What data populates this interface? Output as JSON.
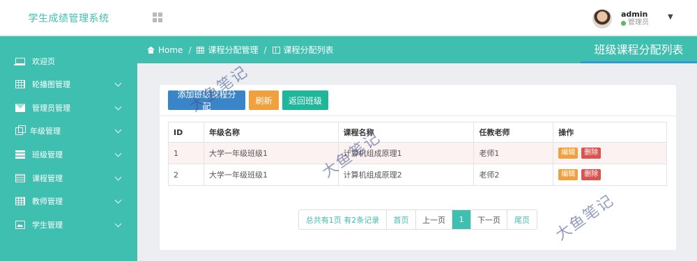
{
  "app": {
    "title": "学生成绩管理系统"
  },
  "user": {
    "name": "admin",
    "role": "管理员",
    "status_color": "#5cb85c"
  },
  "sidebar": {
    "items": [
      {
        "label": "欢迎页",
        "icon": "laptop-icon",
        "expandable": false
      },
      {
        "label": "轮播图管理",
        "icon": "calendar-icon",
        "expandable": true
      },
      {
        "label": "管理员管理",
        "icon": "envelope-icon",
        "expandable": true
      },
      {
        "label": "年级管理",
        "icon": "clone-icon",
        "expandable": true
      },
      {
        "label": "班级管理",
        "icon": "server-icon",
        "expandable": true
      },
      {
        "label": "课程管理",
        "icon": "list-icon",
        "expandable": true
      },
      {
        "label": "教师管理",
        "icon": "table-icon",
        "expandable": true
      },
      {
        "label": "学生管理",
        "icon": "picture-icon",
        "expandable": true
      }
    ]
  },
  "breadcrumb": {
    "home": "Home",
    "level1": "课程分配管理",
    "level2": "课程分配列表",
    "separator": "/"
  },
  "page": {
    "heading": "班级课程分配列表"
  },
  "toolbar": {
    "add_label": "添加班级课程分配",
    "refresh_label": "刷新",
    "back_label": "返回班级"
  },
  "table": {
    "headers": [
      "ID",
      "年级名称",
      "课程名称",
      "任教老师",
      "操作"
    ],
    "rows": [
      {
        "id": "1",
        "grade": "大学一年级班级1",
        "course": "计算机组成原理1",
        "teacher": "老师1",
        "edit": "编辑",
        "delete": "删除"
      },
      {
        "id": "2",
        "grade": "大学一年级班级1",
        "course": "计算机组成原理2",
        "teacher": "老师2",
        "edit": "编辑",
        "delete": "删除"
      }
    ]
  },
  "pagination": {
    "info": "总共有1页 有2条记录",
    "first": "首页",
    "prev": "上一页",
    "current": "1",
    "next": "下一页",
    "last": "尾页"
  },
  "watermark": "大鱼笔记",
  "colors": {
    "accent": "#3fbfb0",
    "primary": "#3a85c8",
    "warning": "#f0a13d",
    "success": "#1fb79a",
    "danger": "#d9534f"
  }
}
